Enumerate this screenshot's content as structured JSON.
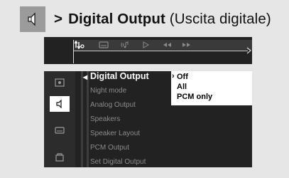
{
  "header": {
    "arrow": ">",
    "title": "Digital Output",
    "subtitle": "(Uscita digitale)",
    "icon": "speaker-icon"
  },
  "toolbar": {
    "icons": [
      "audio-settings-icon",
      "subtitle-icon",
      "audio-icon",
      "play-icon",
      "rewind-icon",
      "fast-forward-icon"
    ]
  },
  "sidebar": {
    "icons": [
      "screen-icon",
      "speaker-icon",
      "subtitle-icon",
      "lock-icon"
    ],
    "selected": "speaker-icon"
  },
  "menu": {
    "items": [
      "Digital Output",
      "Night mode",
      "Analog Output",
      "Speakers",
      "Speaker Layout",
      "PCM Output",
      "Set  Digital  Output"
    ],
    "active_index": 0
  },
  "options": {
    "items": [
      "Off",
      "All",
      "PCM only"
    ],
    "selected_index": 0
  }
}
